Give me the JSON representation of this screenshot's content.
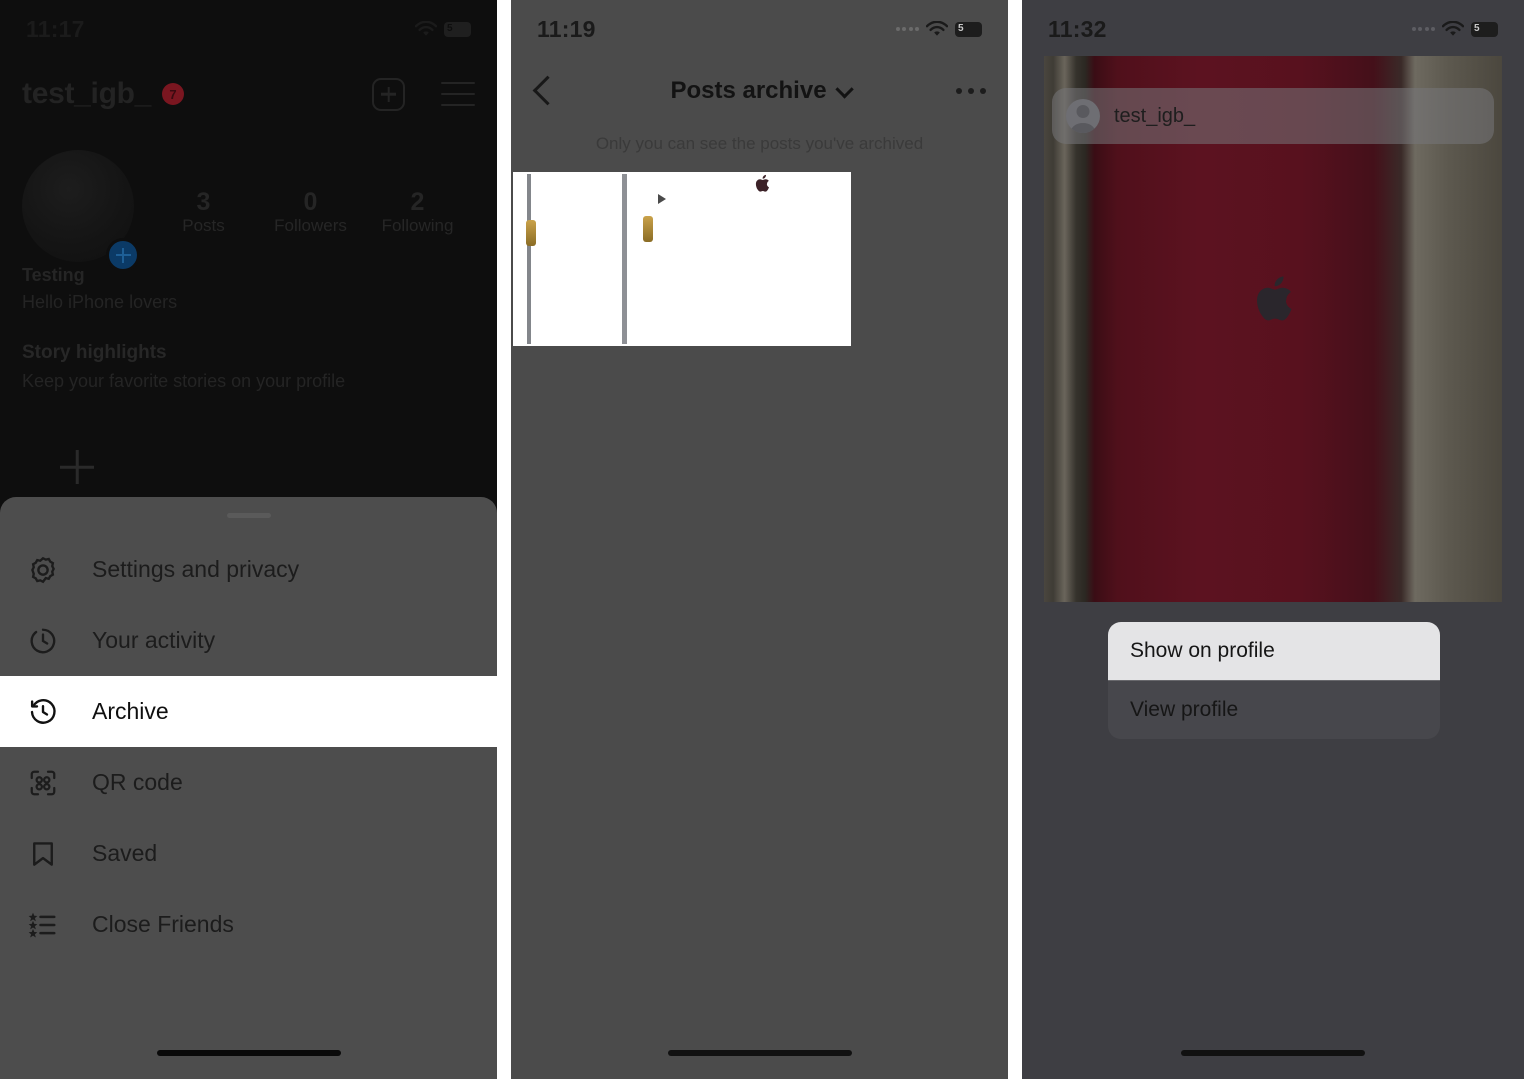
{
  "panels": [
    {
      "id": "instagram-profile-menu",
      "statusbar": {
        "time": "11:17",
        "wifi": "wifi-icon",
        "battery_level": "5"
      },
      "profile": {
        "username": "test_igb_",
        "badge": "7",
        "create_label": "new-post",
        "menu_label": "menu",
        "stats": [
          {
            "num": "3",
            "label": "Posts"
          },
          {
            "num": "0",
            "label": "Followers"
          },
          {
            "num": "2",
            "label": "Following"
          }
        ],
        "bio_name": "Testing",
        "bio_text": "Hello iPhone lovers",
        "highlights_title": "Story highlights",
        "highlights_sub": "Keep your favorite stories on your profile"
      },
      "sheet": {
        "items": [
          {
            "label": "Settings and privacy",
            "icon": "gear-icon",
            "selected": false
          },
          {
            "label": "Your activity",
            "icon": "activity-clock-icon",
            "selected": false
          },
          {
            "label": "Archive",
            "icon": "archive-clock-icon",
            "selected": true
          },
          {
            "label": "QR code",
            "icon": "qr-code-icon",
            "selected": false
          },
          {
            "label": "Saved",
            "icon": "bookmark-icon",
            "selected": false
          },
          {
            "label": "Close Friends",
            "icon": "close-friends-list-icon",
            "selected": false
          }
        ]
      }
    },
    {
      "id": "posts-archive",
      "statusbar": {
        "time": "11:19",
        "wifi": "wifi-icon",
        "battery_level": "5"
      },
      "nav": {
        "back": "back-chevron",
        "title": "Posts archive",
        "title_chevron": "chevron-down-icon",
        "more": "more-options-icon"
      },
      "note": "Only you can see the posts you've archived",
      "grid": [
        {
          "name": "archived-video-post",
          "badge": "play-icon"
        },
        {
          "name": "archived-photo-post",
          "badge": ""
        }
      ]
    },
    {
      "id": "story-highlight-context-menu",
      "statusbar": {
        "time": "11:32",
        "wifi": "wifi-icon",
        "battery_level": "5"
      },
      "profile_bar": {
        "username": "test_igb_",
        "avatar": "avatar-icon"
      },
      "context_menu": [
        {
          "label": "Show on profile",
          "highlighted": true
        },
        {
          "label": "View profile",
          "highlighted": false
        }
      ]
    }
  ],
  "colors": {
    "panel1_bg": "#0e0e0e",
    "panel2_bg": "#4b4b4b",
    "panel3_bg": "#3e3e43",
    "selected_row": "#ffffff",
    "accent_blue": "#0b3a66",
    "badge_red": "#7a1620"
  }
}
